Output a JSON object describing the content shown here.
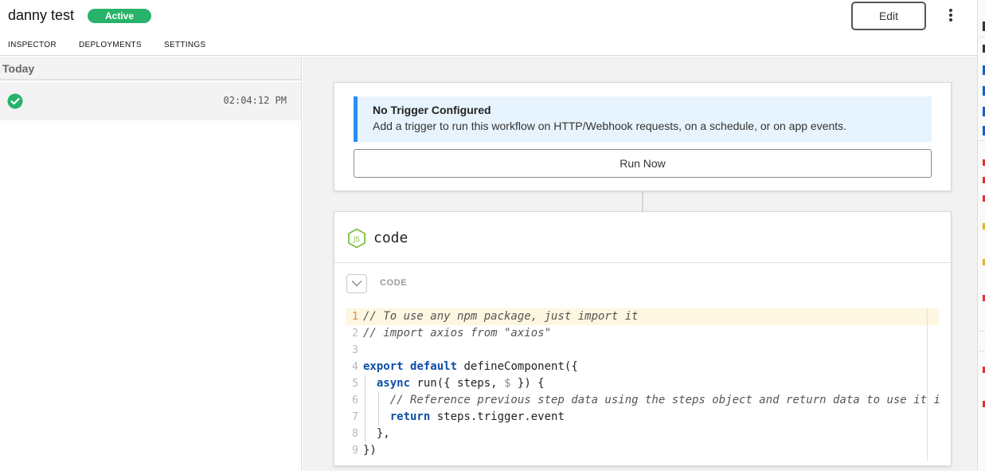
{
  "header": {
    "title": "danny test",
    "status": "Active",
    "status_color": "#27b36a",
    "tabs": [
      "INSPECTOR",
      "DEPLOYMENTS",
      "SETTINGS"
    ],
    "edit_label": "Edit"
  },
  "inspector": {
    "group_label": "Today",
    "events": [
      {
        "status": "success",
        "time": "02:04:12 PM"
      }
    ]
  },
  "trigger": {
    "notice_title": "No Trigger Configured",
    "notice_body": "Add a trigger to run this workflow on HTTP/Webhook requests, on a schedule, or on app events.",
    "run_label": "Run Now",
    "accent_color": "#2a8ff7"
  },
  "step": {
    "icon": "nodejs-icon",
    "name": "code",
    "section_label": "CODE",
    "code_lines": [
      "// To use any npm package, just import it",
      "// import axios from \"axios\"",
      "",
      "export default defineComponent({",
      "  async run({ steps, $ }) {",
      "    // Reference previous step data using the steps object and return data to use it i",
      "    return steps.trigger.event",
      "  },",
      "})"
    ],
    "line_numbers": [
      "1",
      "2",
      "3",
      "4",
      "5",
      "6",
      "7",
      "8",
      "9"
    ]
  }
}
